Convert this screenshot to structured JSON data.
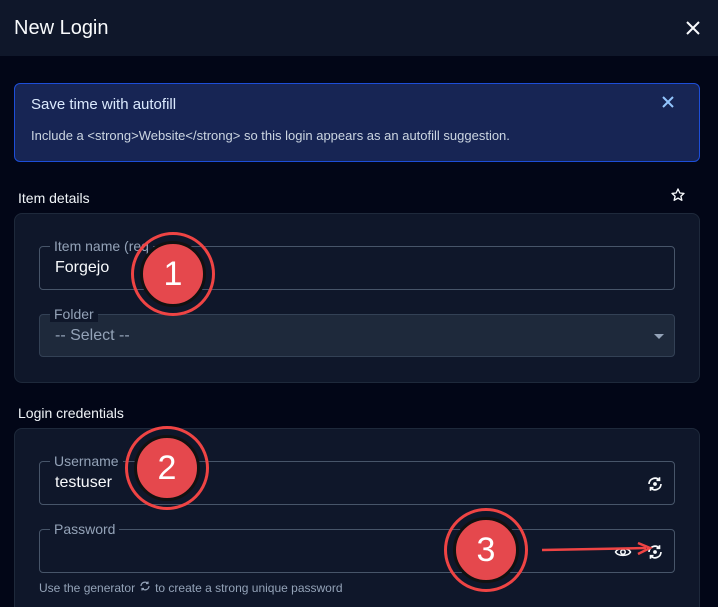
{
  "header": {
    "title": "New Login"
  },
  "banner": {
    "title": "Save time with autofill",
    "text": "Include a <strong>Website</strong> so this login appears as an autofill suggestion."
  },
  "item_details": {
    "label": "Item details",
    "item_name": {
      "legend": "Item name (req",
      "value": "Forgejo"
    },
    "folder": {
      "legend": "Folder",
      "value": "-- Select --"
    }
  },
  "login_credentials": {
    "label": "Login credentials",
    "username": {
      "legend": "Username",
      "value": "testuser"
    },
    "password": {
      "legend": "Password",
      "value": ""
    },
    "helper_before": "Use the generator",
    "helper_after": "to create a strong unique password"
  },
  "callouts": [
    "1",
    "2",
    "3"
  ],
  "colors": {
    "background": "#020617",
    "panel": "#0f172a",
    "banner": "#172554",
    "callout": "#e5484d"
  },
  "icons": [
    "close-icon",
    "star-icon",
    "regenerate-icon",
    "eye-icon",
    "chevron-down-icon"
  ]
}
